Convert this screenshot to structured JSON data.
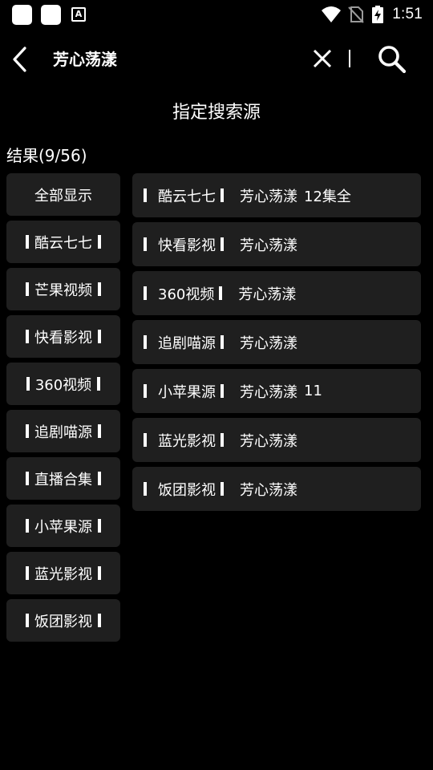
{
  "status_bar": {
    "time": "1:51",
    "icons": [
      "app-icon",
      "app-icon",
      "a-text-icon",
      "wifi-icon",
      "no-sim-icon",
      "battery-charging-icon"
    ]
  },
  "app_bar": {
    "query": "芳心荡漾"
  },
  "section_title": "指定搜索源",
  "result_count": "结果(9/56)",
  "sources": [
    {
      "label": "全部显示",
      "bars": false
    },
    {
      "label": "酷云七七",
      "bars": true
    },
    {
      "label": "芒果视频",
      "bars": true
    },
    {
      "label": "快看影视",
      "bars": true
    },
    {
      "label": "360视频",
      "bars": true
    },
    {
      "label": "追剧喵源",
      "bars": true
    },
    {
      "label": "直播合集",
      "bars": true
    },
    {
      "label": "小苹果源",
      "bars": true
    },
    {
      "label": "蓝光影视",
      "bars": true
    },
    {
      "label": "饭团影视",
      "bars": true
    }
  ],
  "results": [
    {
      "source": "酷云七七",
      "title": "芳心荡漾",
      "extra": "12集全"
    },
    {
      "source": "快看影视",
      "title": "芳心荡漾",
      "extra": ""
    },
    {
      "source": "360视频",
      "title": "芳心荡漾",
      "extra": ""
    },
    {
      "source": "追剧喵源",
      "title": "芳心荡漾",
      "extra": ""
    },
    {
      "source": "小苹果源",
      "title": "芳心荡漾",
      "extra": "11"
    },
    {
      "source": "蓝光影视",
      "title": "芳心荡漾",
      "extra": ""
    },
    {
      "source": "饭团影视",
      "title": "芳心荡漾",
      "extra": ""
    }
  ]
}
